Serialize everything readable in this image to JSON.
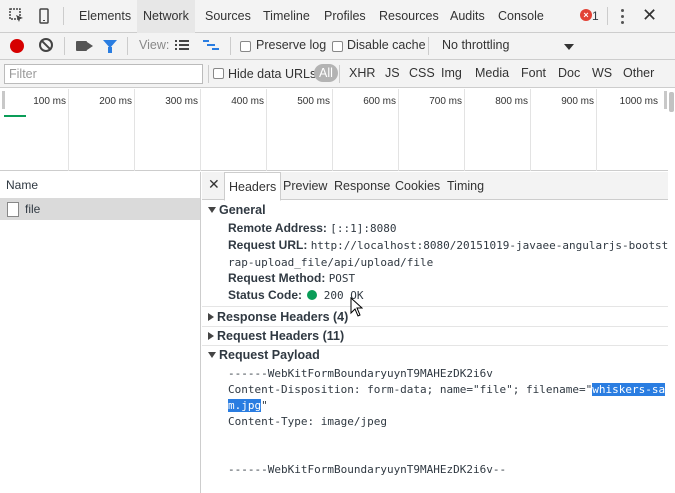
{
  "panels": {
    "tabs": [
      "Elements",
      "Network",
      "Sources",
      "Timeline",
      "Profiles",
      "Resources",
      "Audits",
      "Console"
    ],
    "active": "Network",
    "error_count": "1"
  },
  "toolbar": {
    "view_label": "View:",
    "preserve_log": "Preserve log",
    "disable_cache": "Disable cache",
    "throttling": "No throttling"
  },
  "filter": {
    "placeholder": "Filter",
    "hide_data_urls": "Hide data URLs",
    "types": [
      "All",
      "XHR",
      "JS",
      "CSS",
      "Img",
      "Media",
      "Font",
      "Doc",
      "WS",
      "Other"
    ]
  },
  "timeline": {
    "ticks": [
      "100 ms",
      "200 ms",
      "300 ms",
      "400 ms",
      "500 ms",
      "600 ms",
      "700 ms",
      "800 ms",
      "900 ms",
      "1000 ms"
    ]
  },
  "requests": {
    "header": "Name",
    "rows": [
      {
        "name": "file"
      }
    ]
  },
  "details": {
    "tabs": [
      "Headers",
      "Preview",
      "Response",
      "Cookies",
      "Timing"
    ],
    "active": "Headers",
    "general": {
      "title": "General",
      "remote_address_label": "Remote Address:",
      "remote_address": "[::1]:8080",
      "request_url_label": "Request URL:",
      "request_url_1": "http://localhost:8080/20151019-javaee-angularjs-bootst",
      "request_url_2": "rap-upload_file/api/upload/file",
      "request_method_label": "Request Method:",
      "request_method": "POST",
      "status_code_label": "Status Code:",
      "status_code": "200 OK",
      "status_color": "#0a9d58"
    },
    "response_headers": "Response Headers (4)",
    "request_headers": "Request Headers (11)",
    "payload": {
      "title": "Request Payload",
      "line1": "------WebKitFormBoundaryuynT9MAHEzDK2i6v",
      "line2_pre": "Content-Disposition: form-data; name=\"file\"; filename=\"",
      "line2_sel": "whiskers-sa",
      "line3_sel": "m.jpg",
      "line3_post": "\"",
      "line4": "Content-Type: image/jpeg",
      "line5": "------WebKitFormBoundaryuynT9MAHEzDK2i6v--"
    }
  }
}
